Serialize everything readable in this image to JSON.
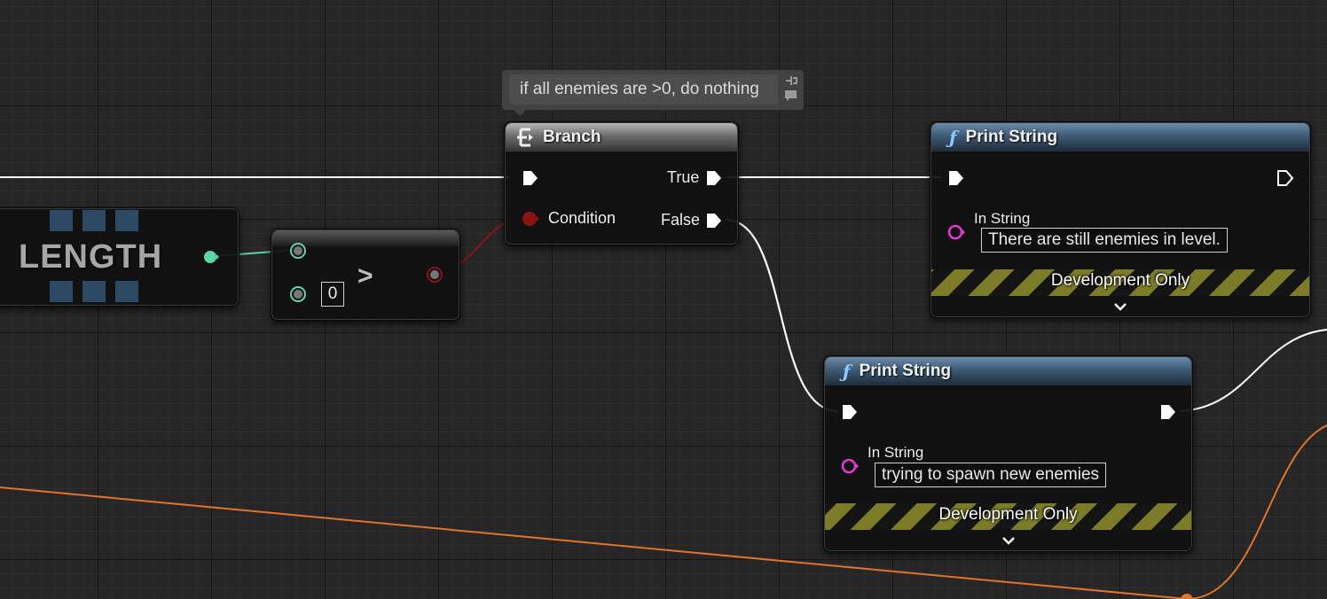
{
  "comment": {
    "text": "if all enemies are >0, do nothing"
  },
  "branch_node": {
    "title": "Branch",
    "pins": {
      "condition": "Condition",
      "true": "True",
      "false": "False"
    }
  },
  "length_node": {
    "title": "LENGTH"
  },
  "compare_node": {
    "operator": ">",
    "value": "0"
  },
  "print_string_1": {
    "title": "Print String",
    "in_string_label": "In String",
    "in_string_value": "There are still enemies in level.",
    "dev_label": "Development Only"
  },
  "print_string_2": {
    "title": "Print String",
    "in_string_label": "In String",
    "in_string_value": "trying to spawn new enemies",
    "dev_label": "Development Only"
  },
  "colors": {
    "exec_wire": "#ffffff",
    "int_pin": "#5bd6a2",
    "bool_pin": "#8c1313",
    "string_pin": "#e33ad3",
    "object_wire": "#e0752a",
    "func_header": "#3e5a76",
    "dev_stripe": "#7b7b28"
  }
}
